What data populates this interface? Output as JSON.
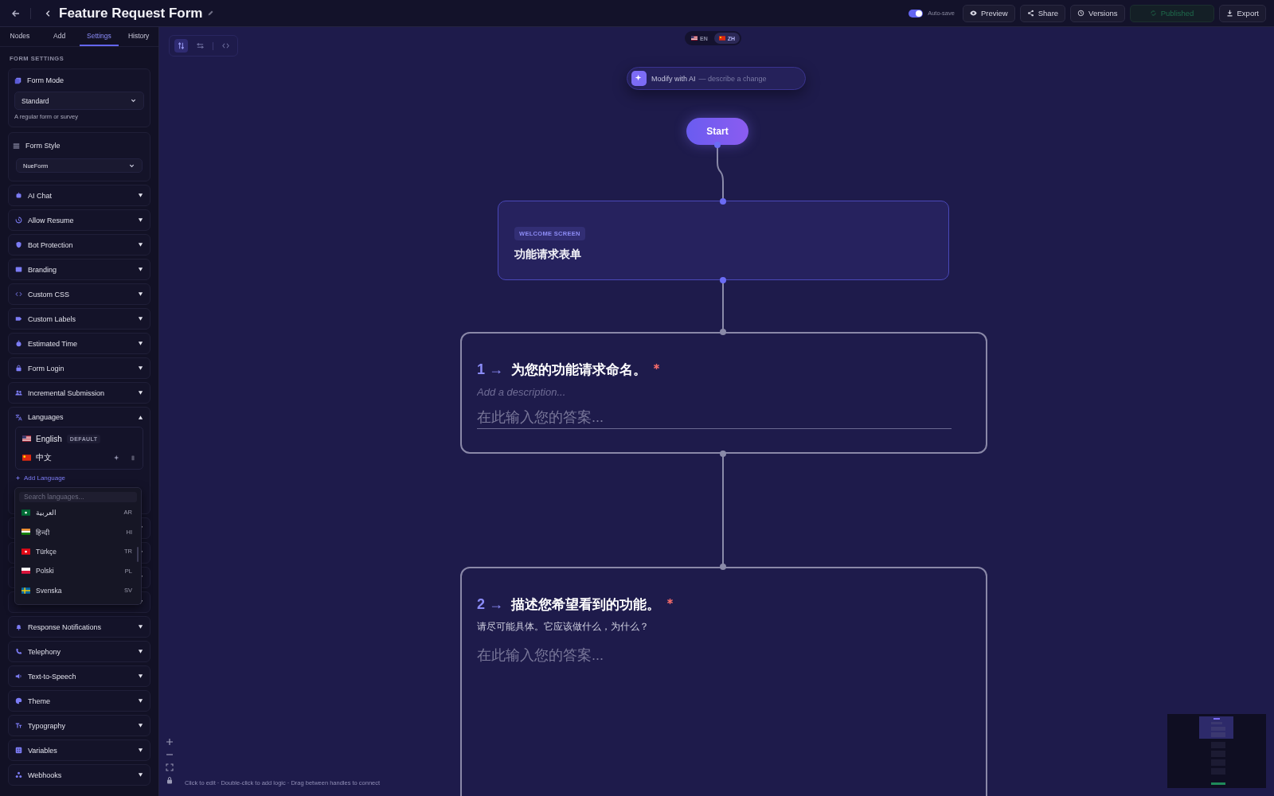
{
  "header": {
    "title": "Feature Request Form",
    "autosave": {
      "label": "Auto-save",
      "on": true
    },
    "buttons": [
      {
        "label": "Preview",
        "kind": "preview",
        "disabled": false
      },
      {
        "label": "Share",
        "kind": "share",
        "disabled": false
      },
      {
        "label": "Versions",
        "kind": "versions",
        "disabled": false
      },
      {
        "label": "Published",
        "kind": "published",
        "disabled": true
      },
      {
        "label": "Export",
        "kind": "export",
        "disabled": false
      }
    ]
  },
  "sidebar": {
    "tabs": [
      {
        "label": "Nodes",
        "selected": false
      },
      {
        "label": "Add",
        "selected": false
      },
      {
        "label": "Settings",
        "selected": true
      },
      {
        "label": "History",
        "selected": false
      }
    ],
    "section_title": "FORM SETTINGS",
    "form_mode": {
      "label": "Form Mode",
      "value": "Standard",
      "hint": "A regular form or survey"
    },
    "form_style": {
      "label": "Form Style",
      "value": "NueForm"
    },
    "sections_before": [
      {
        "label": "AI Chat",
        "kind": "bot",
        "expanded": false
      },
      {
        "label": "Allow Resume",
        "kind": "history",
        "expanded": false
      },
      {
        "label": "Bot Protection",
        "kind": "shield",
        "expanded": false
      },
      {
        "label": "Branding",
        "kind": "image",
        "expanded": false
      },
      {
        "label": "Custom CSS",
        "kind": "code",
        "expanded": false
      },
      {
        "label": "Custom Labels",
        "kind": "label",
        "expanded": false
      },
      {
        "label": "Estimated Time",
        "kind": "timer",
        "expanded": false
      },
      {
        "label": "Form Login",
        "kind": "lock",
        "expanded": false
      },
      {
        "label": "Incremental Submission",
        "kind": "users",
        "expanded": false
      }
    ],
    "languages": {
      "label": "Languages",
      "expanded": true,
      "items": [
        {
          "name": "English",
          "kind": "us",
          "badge": "DEFAULT"
        },
        {
          "name": "中文",
          "kind": "cn"
        }
      ],
      "add_label": "Add Language",
      "dropdown": {
        "placeholder": "Search languages...",
        "options": [
          {
            "name": "العربية",
            "code": "AR",
            "kind": "sa"
          },
          {
            "name": "हिन्दी",
            "code": "HI",
            "kind": "in"
          },
          {
            "name": "Türkçe",
            "code": "TR",
            "kind": "tr"
          },
          {
            "name": "Polski",
            "code": "PL",
            "kind": "pl"
          },
          {
            "name": "Svenska",
            "code": "SV",
            "kind": "se"
          }
        ]
      }
    },
    "covered_sections": [
      {
        "expanded": false
      },
      {
        "expanded": false
      },
      {
        "expanded": false
      },
      {
        "expanded": false
      }
    ],
    "sections_after": [
      {
        "label": "Response Notifications",
        "kind": "bell",
        "expanded": false
      },
      {
        "label": "Telephony",
        "kind": "phone",
        "expanded": false
      },
      {
        "label": "Text-to-Speech",
        "kind": "speaker",
        "expanded": false
      },
      {
        "label": "Theme",
        "kind": "palette",
        "expanded": false
      },
      {
        "label": "Typography",
        "kind": "type",
        "expanded": false
      },
      {
        "label": "Variables",
        "kind": "grid",
        "expanded": false
      },
      {
        "label": "Webhooks",
        "kind": "webhook",
        "expanded": false
      }
    ]
  },
  "canvas": {
    "language_switch": [
      {
        "label": "EN",
        "kind": "us",
        "selected": false
      },
      {
        "label": "ZH",
        "kind": "cn",
        "selected": true
      }
    ],
    "ai_bar": {
      "label": "Modify with AI",
      "placeholder": "— describe a change"
    },
    "start": "Start",
    "welcome": {
      "badge": "WELCOME SCREEN",
      "title": "功能请求表单"
    },
    "questions": [
      {
        "label": "1 →",
        "title": "为您的功能请求命名。",
        "required": true,
        "description_placeholder": "Add a description...",
        "answer_placeholder": "在此输入您的答案..."
      },
      {
        "label": "2 →",
        "title": "描述您希望看到的功能。",
        "required": true,
        "description": "请尽可能具体。它应该做什么，为什么？",
        "answer_placeholder": "在此输入您的答案..."
      }
    ],
    "hint": "Click to edit · Double-click to add logic · Drag between handles to connect"
  }
}
